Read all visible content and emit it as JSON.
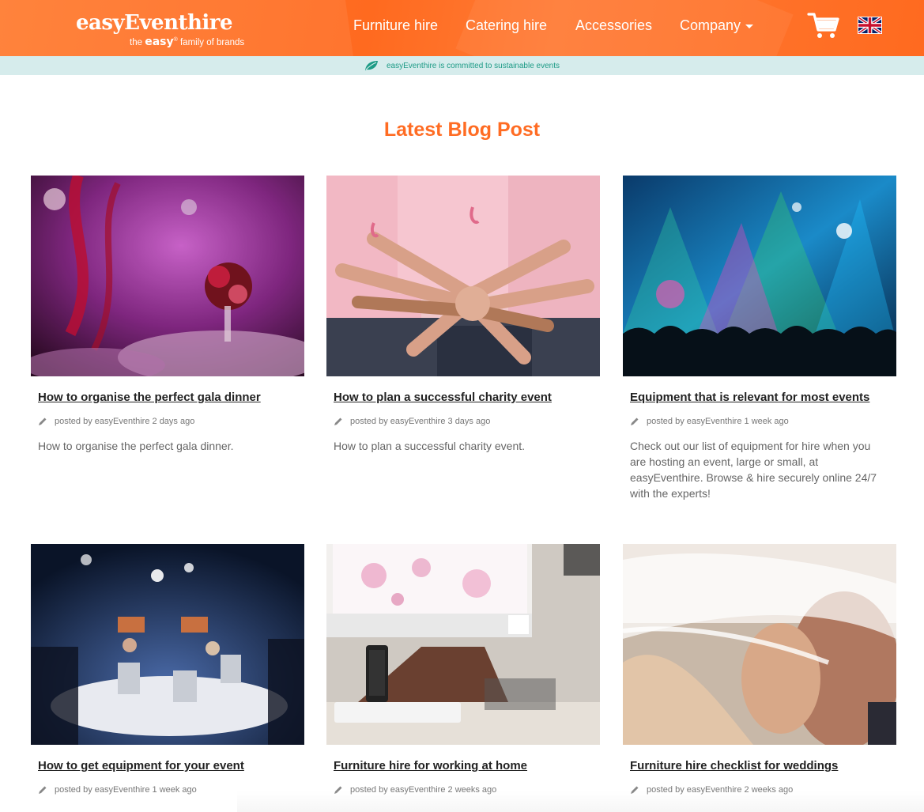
{
  "header": {
    "logo_main": "easyEventhire",
    "logo_sub_prefix": "the",
    "logo_sub_brand": "easy",
    "logo_sub_reg": "®",
    "logo_sub_suffix": "family of brands",
    "nav": [
      {
        "label": "Furniture hire"
      },
      {
        "label": "Catering hire"
      },
      {
        "label": "Accessories"
      },
      {
        "label": "Company"
      }
    ],
    "cart_icon": "shopping-cart-icon",
    "flag_icon": "uk-flag-icon"
  },
  "sustainability": {
    "icon": "leaf-icon",
    "text": "easyEventhire is committed to sustainable events"
  },
  "section": {
    "title": "Latest Blog Post"
  },
  "colors": {
    "accent": "#ff6c23",
    "sustain_bg": "#d6ecec",
    "sustain_text": "#1d9b86"
  },
  "posts": [
    {
      "title": "How to organise the perfect gala dinner",
      "meta": "posted by easyEventhire 2 days ago",
      "excerpt": "How to organise the perfect gala dinner.",
      "image": "gala-dinner-photo"
    },
    {
      "title": "How to plan a successful charity event",
      "meta": "posted by easyEventhire 3 days ago",
      "excerpt": "How to plan a successful charity event.",
      "image": "charity-hands-photo"
    },
    {
      "title": "Equipment that is relevant for most events",
      "meta": "posted by easyEventhire 1 week ago",
      "excerpt": "Check out our list of equipment for hire when you are hosting an event, large or small, at easyEventhire. Browse & hire securely online 24/7 with the experts!",
      "image": "concert-crowd-photo"
    },
    {
      "title": "How to get equipment for your event",
      "meta": "posted by easyEventhire 1 week ago",
      "excerpt": "",
      "image": "panel-discussion-photo"
    },
    {
      "title": "Furniture hire for working at home",
      "meta": "posted by easyEventhire 2 weeks ago",
      "excerpt": "",
      "image": "home-office-desk-photo"
    },
    {
      "title": "Furniture hire checklist for weddings",
      "meta": "posted by easyEventhire 2 weeks ago",
      "excerpt": "",
      "image": "wedding-veil-photo"
    }
  ]
}
